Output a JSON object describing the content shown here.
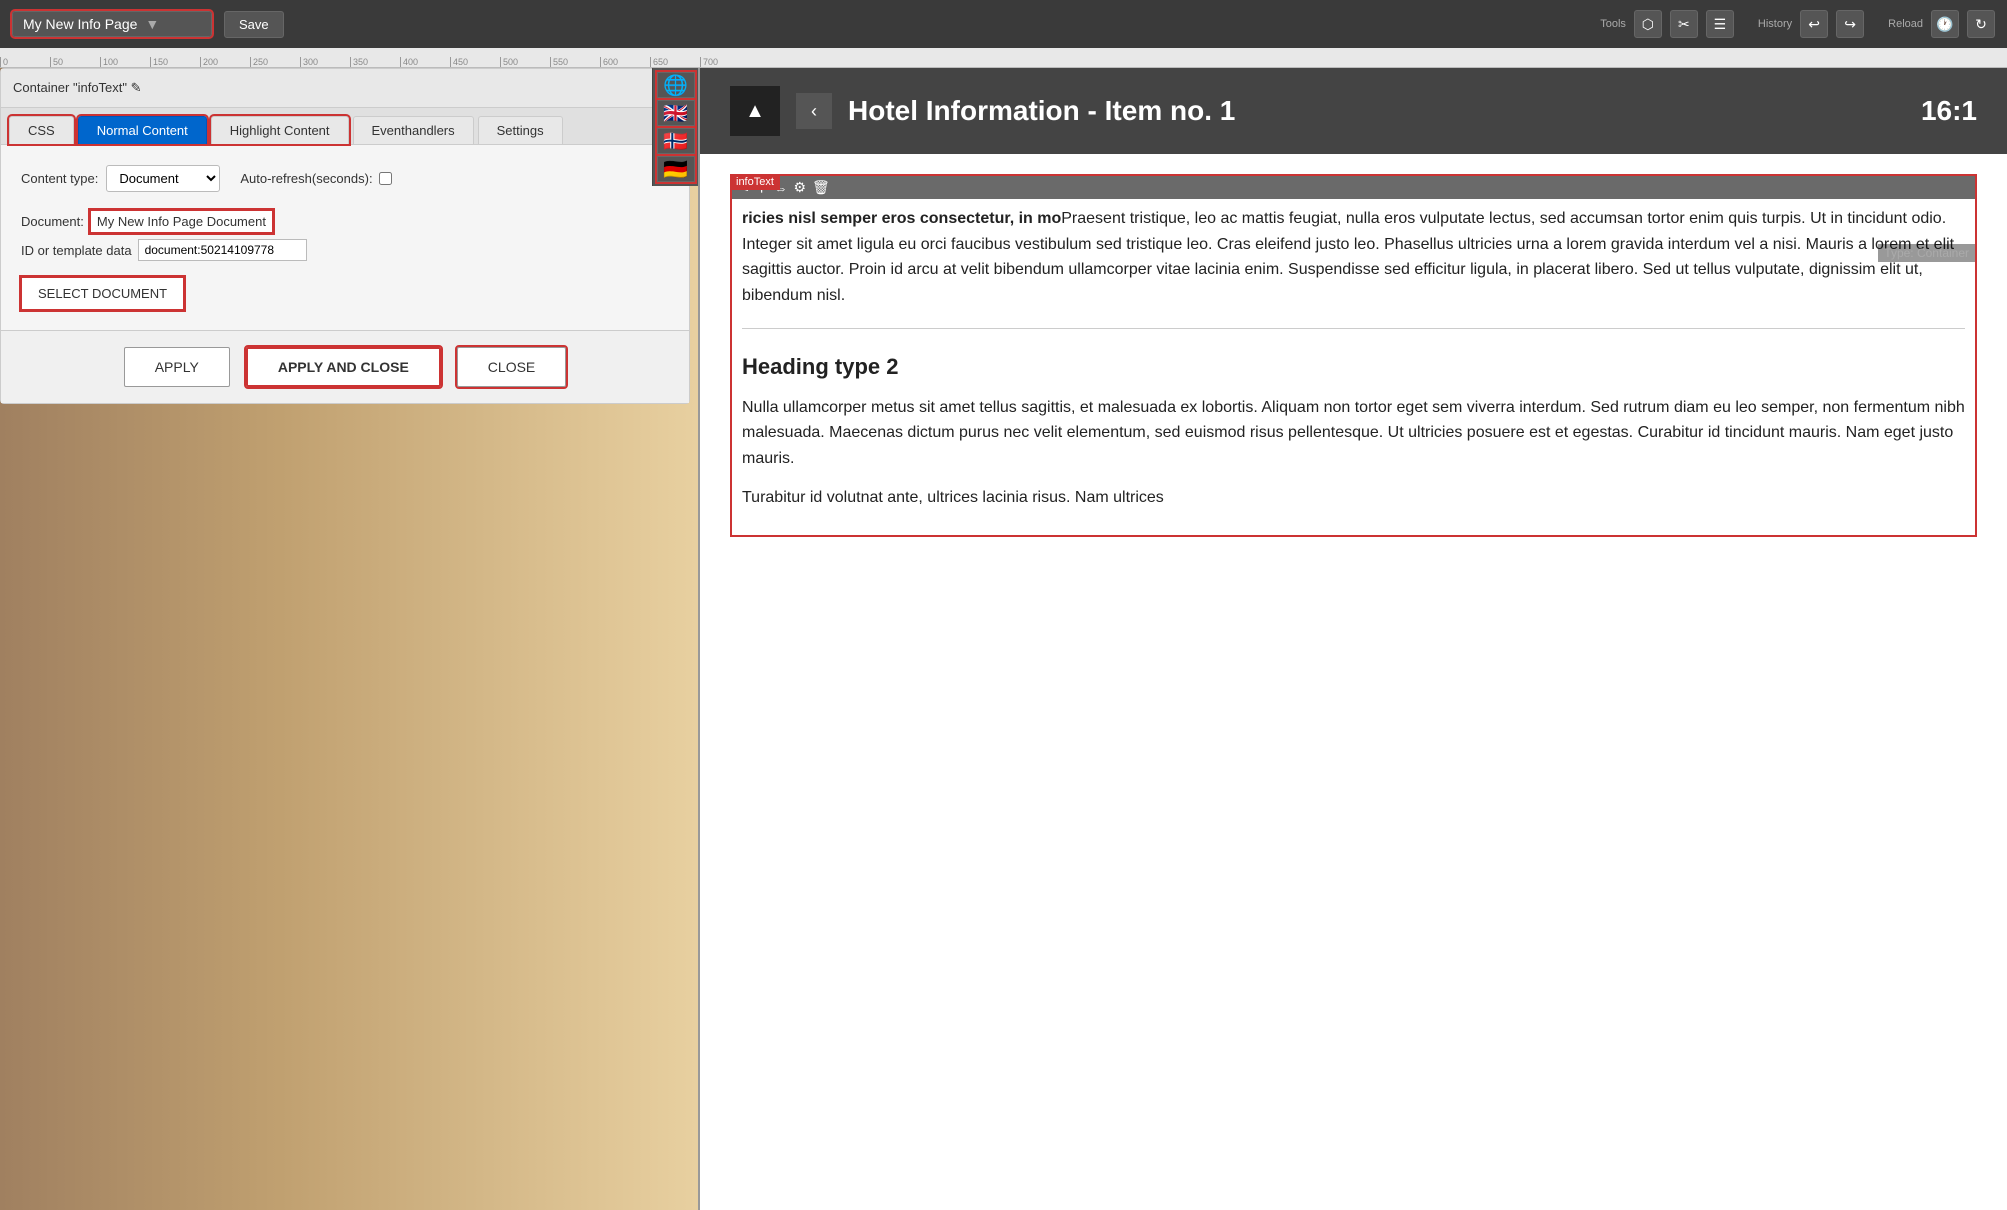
{
  "topbar": {
    "page_selector_label": "My New Info Page",
    "save_button": "Save",
    "tools_label": "Tools",
    "history_label": "History",
    "reload_label": "Reload"
  },
  "dialog": {
    "header": "Container \"infoText\" ✎",
    "tabs": [
      "CSS",
      "Normal Content",
      "Highlight Content",
      "Eventhandlers",
      "Settings"
    ],
    "active_tab": "Normal Content",
    "content_type_label": "Content type:",
    "content_type_value": "Document",
    "auto_refresh_label": "Auto-refresh(seconds):",
    "doc_label": "Document:",
    "doc_name": "My New Info Page Document",
    "id_label": "ID or template data",
    "id_value": "document:50214109778",
    "select_doc_btn": "SELECT DOCUMENT",
    "footer": {
      "apply": "APPLY",
      "apply_close": "APPLY AND CLOSE",
      "close": "CLOSE"
    }
  },
  "flags": [
    "🌐",
    "🇬🇧",
    "🇳🇴",
    "🇩🇪"
  ],
  "page": {
    "title": "Hotel Information - Item no. 1",
    "time": "16:1",
    "container_label": "infoText",
    "container_type": "Type: Container",
    "body_text_1": "ricies nisl semper eros consectetur, in mo",
    "body_text_2": "Praesent tristique, leo ac mattis feugiat, nulla eros vulputate lectus, sed accumsan tortor enim quis turpis. Ut in tincidunt odio. Integer sit amet ligula eu orci faucibus vestibulum sed tristique leo. Cras eleifend justo leo. Phasellus ultricies urna a lorem gravida interdum vel a nisi. Mauris a lorem et elit sagittis auctor. Proin id arcu at velit bibendum ullamcorper vitae lacinia enim. Suspendisse sed efficitur ligula, in placerat libero. Sed ut tellus vulputate, dignissim elit ut, bibendum nisl.",
    "heading2": "Heading type 2",
    "body_text_3": "Nulla ullamcorper metus sit amet tellus sagittis, et malesuada ex lobortis. Aliquam non tortor eget sem viverra interdum. Sed rutrum diam eu leo semper, non fermentum nibh malesuada. Maecenas dictum purus nec velit elementum, sed euismod risus pellentesque. Ut ultricies posuere est et egestas. Curabitur id tincidunt mauris. Nam eget justo mauris.",
    "body_text_4": "Turabitur id volutnat ante, ultrices lacinia risus. Nam ultrices"
  }
}
